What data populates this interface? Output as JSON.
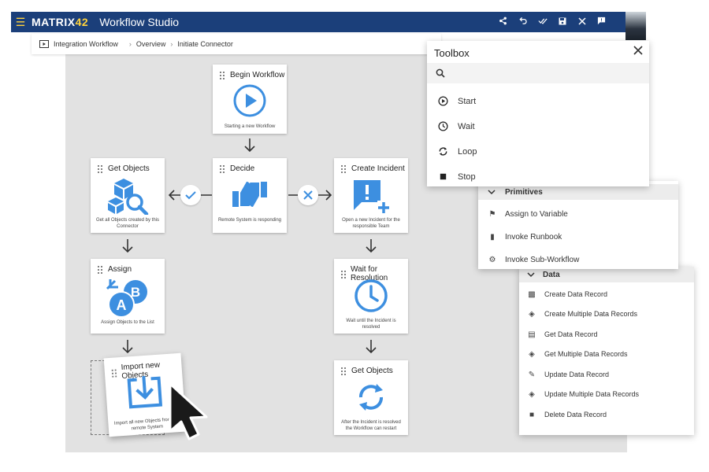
{
  "app": {
    "logo_prefix": "MATRIX",
    "logo_suffix": "42",
    "title": "Workflow Studio",
    "menu_icon": "hamburger-icon",
    "tools": [
      "share-icon",
      "undo-icon",
      "check-all-icon",
      "save-icon",
      "close-icon",
      "feedback-icon"
    ]
  },
  "breadcrumb": {
    "root": "Integration Workflow",
    "items": [
      "Overview",
      "Initiate Connector"
    ]
  },
  "nodes": {
    "begin": {
      "title": "Begin Workflow",
      "desc": "Starting a new Workflow"
    },
    "decide": {
      "title": "Decide",
      "desc": "Remote System is responding"
    },
    "get_objects": {
      "title": "Get Objects",
      "desc": "Get all Objects created by this Connector"
    },
    "create_incident": {
      "title": "Create Incident",
      "desc": "Open a new Incident for the responsible Team"
    },
    "assign": {
      "title": "Assign",
      "desc": "Assign Objects to the List"
    },
    "wait_resolution": {
      "title": "Wait for Resolution",
      "desc": "Wait until the Incident is resolved"
    },
    "import": {
      "title": "Import new Objects",
      "desc": "Import all new Objects from the remote System"
    },
    "get_objects_2": {
      "title": "Get Objects",
      "desc": "After the Incident is resolved the Workflow can restart"
    }
  },
  "toolbox": {
    "title": "Toolbox",
    "search_placeholder": "",
    "items": [
      {
        "label": "Start",
        "icon": "play-circle-icon"
      },
      {
        "label": "Wait",
        "icon": "clock-icon"
      },
      {
        "label": "Loop",
        "icon": "loop-icon"
      },
      {
        "label": "Stop",
        "icon": "stop-icon"
      }
    ]
  },
  "primitives": {
    "title": "Primitives",
    "items": [
      {
        "label": "Assign to Variable",
        "icon": "variable-icon"
      },
      {
        "label": "Invoke Runbook",
        "icon": "runbook-icon"
      },
      {
        "label": "Invoke Sub-Workflow",
        "icon": "gear-icon"
      }
    ]
  },
  "data_section": {
    "title": "Data",
    "items": [
      {
        "label": "Create Data Record"
      },
      {
        "label": "Create Multiple Data Records"
      },
      {
        "label": "Get Data Record"
      },
      {
        "label": "Get Multiple Data Records"
      },
      {
        "label": "Update Data Record"
      },
      {
        "label": "Update Multiple Data Records"
      },
      {
        "label": "Delete Data Record"
      }
    ]
  },
  "colors": {
    "brand_bar": "#1b3f7a",
    "accent_blue": "#3d8fe0",
    "canvas": "#e2e2e2"
  }
}
